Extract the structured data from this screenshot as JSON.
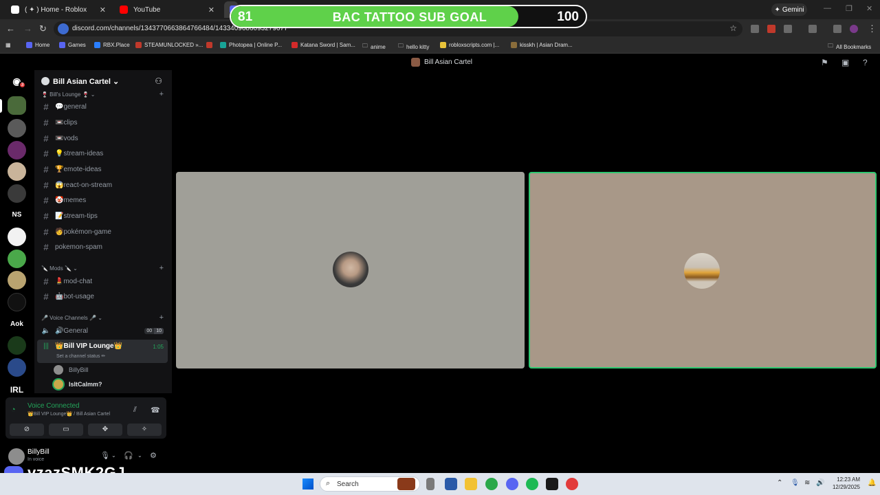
{
  "browser": {
    "tabs": [
      {
        "title": "( ✦ ) Home - Roblox",
        "favicon_color": "#ffffff"
      },
      {
        "title": "YouTube",
        "favicon_color": "#ff0000"
      },
      {
        "title": "",
        "favicon_color": "#5865f2"
      }
    ],
    "gemini_label": "Gemini",
    "url": "discord.com/channels/1343770663864766484/1433409686093279677",
    "bookmarks": [
      {
        "label": "Home",
        "color": "#5865f2"
      },
      {
        "label": "Games",
        "color": "#5865f2"
      },
      {
        "label": "RBX.Place",
        "color": "#2a7fff"
      },
      {
        "label": "STEAMUNLOCKED »...",
        "color": "#c0392b"
      },
      {
        "label": "",
        "color": "#c0392b"
      },
      {
        "label": "Photopea | Online P...",
        "color": "#18a497"
      },
      {
        "label": "Katana Sword | Sam...",
        "color": "#d42a2a"
      },
      {
        "label": "anime",
        "color": "#e3e3e3"
      },
      {
        "label": "hello kitty",
        "color": "#e3e3e3"
      },
      {
        "label": "robloxscripts.com |...",
        "color": "#e8c33a"
      },
      {
        "label": "kisskh | Asian Dram...",
        "color": "#8a6d3b"
      }
    ],
    "all_bookmarks": "All Bookmarks"
  },
  "sub_goal": {
    "title": "BAC TATTOO SUB GOAL",
    "current": "81",
    "target": "100",
    "progress": 0.81,
    "fill_color": "#5fd14a"
  },
  "discord": {
    "window_title": "Bill Asian Cartel",
    "rail": {
      "dm_badge": "3",
      "server_labels": [
        "NS",
        "Aok",
        "IRL"
      ]
    },
    "server": {
      "name": "Bill Asian Cartel",
      "categories": [
        {
          "name": "🍷 Bill's Lounge 🍷"
        },
        {
          "name": "🔪 Mods 🔪"
        },
        {
          "name": "🎤 Voice Channels 🎤"
        }
      ],
      "text_channels": [
        "💬general",
        "📼clips",
        "📼vods",
        "💡stream-ideas",
        "🏆emote-ideas",
        "😱react-on-stream",
        "🤡memes",
        "📝stream-tips",
        "🧑pokémon-game",
        "pokemon-spam"
      ],
      "mod_channels": [
        "💄mod-chat",
        "🤖bot-usage"
      ],
      "voice_channels": [
        {
          "name": "🔊General",
          "count_a": "00",
          "count_b": "10"
        },
        {
          "name": "👑Bill VIP Lounge👑",
          "status": "Set a channel status ✏",
          "timer": "1:05"
        }
      ],
      "voice_users": [
        {
          "name": "BillyBill",
          "color": "#949ba4"
        },
        {
          "name": "IsItCalmm?",
          "color": "#dbdee1"
        }
      ]
    },
    "voice_panel": {
      "title": "Voice Connected",
      "subtitle": "👑Bill VIP Lounge👑 / Bill Asian Cartel"
    },
    "user": {
      "name": "BillyBill",
      "status": "In voice"
    }
  },
  "watermark": "vzazSMK2GJ",
  "taskbar": {
    "search_placeholder": "Search",
    "time": "12:23 AM",
    "date": "12/29/2025"
  }
}
